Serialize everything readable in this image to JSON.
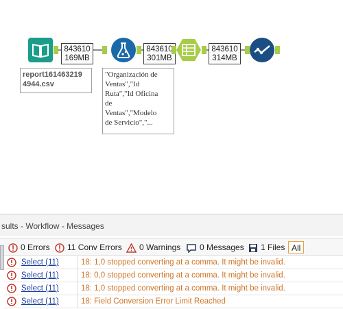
{
  "workflow": {
    "tools": [
      {
        "name": "input-data-tool",
        "icon": "book-icon",
        "color": "#1a9d8a"
      },
      {
        "name": "formula-tool",
        "icon": "flask-icon",
        "color": "#1a69a8"
      },
      {
        "name": "select-tool",
        "icon": "select-table-icon",
        "color": "#a7cc47"
      },
      {
        "name": "browse-tool",
        "icon": "browse-check-icon",
        "color": "#1b4f83"
      }
    ],
    "connections": [
      {
        "records": "843610",
        "size": "169MB"
      },
      {
        "records": "843610",
        "size": "301MB"
      },
      {
        "records": "843610",
        "size": "314MB"
      }
    ],
    "annotations": {
      "input": [
        "report161463219",
        "4944.csv"
      ],
      "formula": [
        "\"Organización de",
        "Ventas\",\"Id",
        "Ruta\",\"Id Oficina",
        "de",
        "Ventas\",\"Modelo",
        "de Servicio\",\"..."
      ]
    }
  },
  "results": {
    "title": "sults - Workflow - Messages",
    "filters": {
      "errors": "0 Errors",
      "conv_errors": "11 Conv Errors",
      "warnings": "0 Warnings",
      "messages": "0 Messages",
      "files": "1 Files",
      "all": "All"
    },
    "rows": [
      {
        "tool": "Select (11)",
        "message": "18: 1,0 stopped converting at a comma. It might be invalid."
      },
      {
        "tool": "Select (11)",
        "message": "18: 0,0 stopped converting at a comma. It might be invalid."
      },
      {
        "tool": "Select (11)",
        "message": "18: 1,0 stopped converting at a comma. It might be invalid."
      },
      {
        "tool": "Select (11)",
        "message": "18: Field Conversion Error Limit Reached"
      }
    ]
  },
  "colors": {
    "anchor": "#a7cc47",
    "error_icon": "#c0392b",
    "message_text": "#d0762a",
    "link": "#1a3fa0"
  }
}
